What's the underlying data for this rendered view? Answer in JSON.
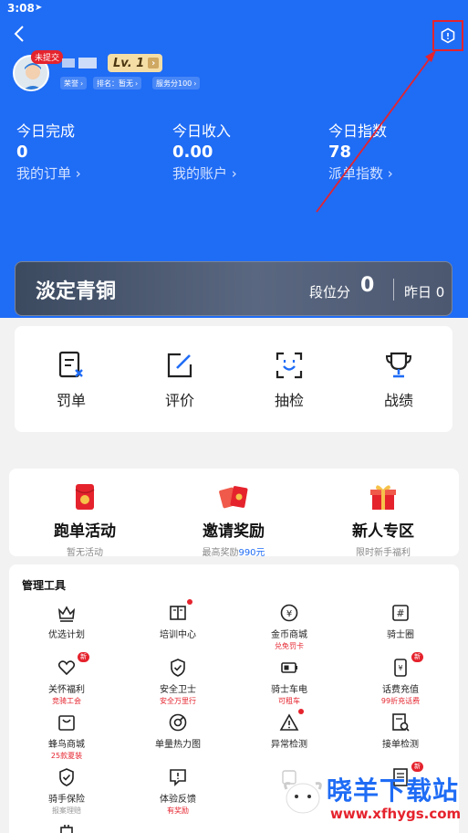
{
  "status": {
    "time": "3:08"
  },
  "profile": {
    "tag": "未提交",
    "level": "Lv. 1",
    "chips": [
      "荣誉",
      "排名：暂无",
      "服务分100"
    ]
  },
  "stats": [
    {
      "label": "今日完成",
      "value": "0",
      "link": "我的订单"
    },
    {
      "label": "今日收入",
      "value": "0.00",
      "link": "我的账户"
    },
    {
      "label": "今日指数",
      "value": "78",
      "link": "派单指数"
    }
  ],
  "rank": {
    "name": "淡定青铜",
    "score_label": "段位分",
    "score": "0",
    "yesterday": "昨日 0"
  },
  "quick": [
    {
      "label": "罚单",
      "icon": "penalty-icon"
    },
    {
      "label": "评价",
      "icon": "edit-icon"
    },
    {
      "label": "抽检",
      "icon": "face-scan-icon"
    },
    {
      "label": "战绩",
      "icon": "trophy-icon"
    }
  ],
  "promo": [
    {
      "title": "跑单活动",
      "sub": "暂无活动",
      "icon": "red-envelope-icon"
    },
    {
      "title": "邀请奖励",
      "sub": "最高奖励",
      "sub_hl": "990元",
      "icon": "red-packets-icon"
    },
    {
      "title": "新人专区",
      "sub": "限时新手福利",
      "icon": "gift-box-icon"
    }
  ],
  "tools": {
    "title": "管理工具",
    "items": [
      {
        "label": "优选计划",
        "sub": "",
        "icon": "crown-icon"
      },
      {
        "label": "培训中心",
        "sub": "",
        "icon": "book-icon",
        "dot": true
      },
      {
        "label": "金币商城",
        "sub": "兑免罚卡",
        "icon": "coin-icon"
      },
      {
        "label": "骑士圈",
        "sub": "",
        "icon": "hash-icon"
      },
      {
        "label": "关怀福利",
        "sub": "竞骑工会",
        "icon": "heart-icon",
        "badge": "新"
      },
      {
        "label": "安全卫士",
        "sub": "安全万里行",
        "icon": "shield-icon"
      },
      {
        "label": "骑士车电",
        "sub": "可租车",
        "icon": "battery-icon"
      },
      {
        "label": "话费充值",
        "sub": "99折充话费",
        "icon": "phone-bill-icon",
        "badge": "新"
      },
      {
        "label": "蜂鸟商城",
        "sub": "25款夏装",
        "icon": "mall-icon"
      },
      {
        "label": "单量热力图",
        "sub": "",
        "icon": "heatmap-icon"
      },
      {
        "label": "异常检测",
        "sub": "",
        "icon": "warning-icon",
        "dot": true
      },
      {
        "label": "接单检测",
        "sub": "",
        "icon": "order-check-icon"
      },
      {
        "label": "骑手保险",
        "sub": "报案理赔",
        "icon": "insurance-icon"
      },
      {
        "label": "体验反馈",
        "sub": "有奖励",
        "icon": "feedback-icon"
      },
      {
        "label": "",
        "sub": "",
        "icon": "unknown-icon"
      },
      {
        "label": "",
        "sub": "",
        "icon": "doc-icon",
        "badge": "新"
      }
    ]
  },
  "watermark": {
    "text": "晓羊下载站",
    "url": "www.xfhygs.com"
  },
  "colors": {
    "primary": "#1f6cf5",
    "accent_red": "#e5232d",
    "gold": "#f5dea6"
  }
}
